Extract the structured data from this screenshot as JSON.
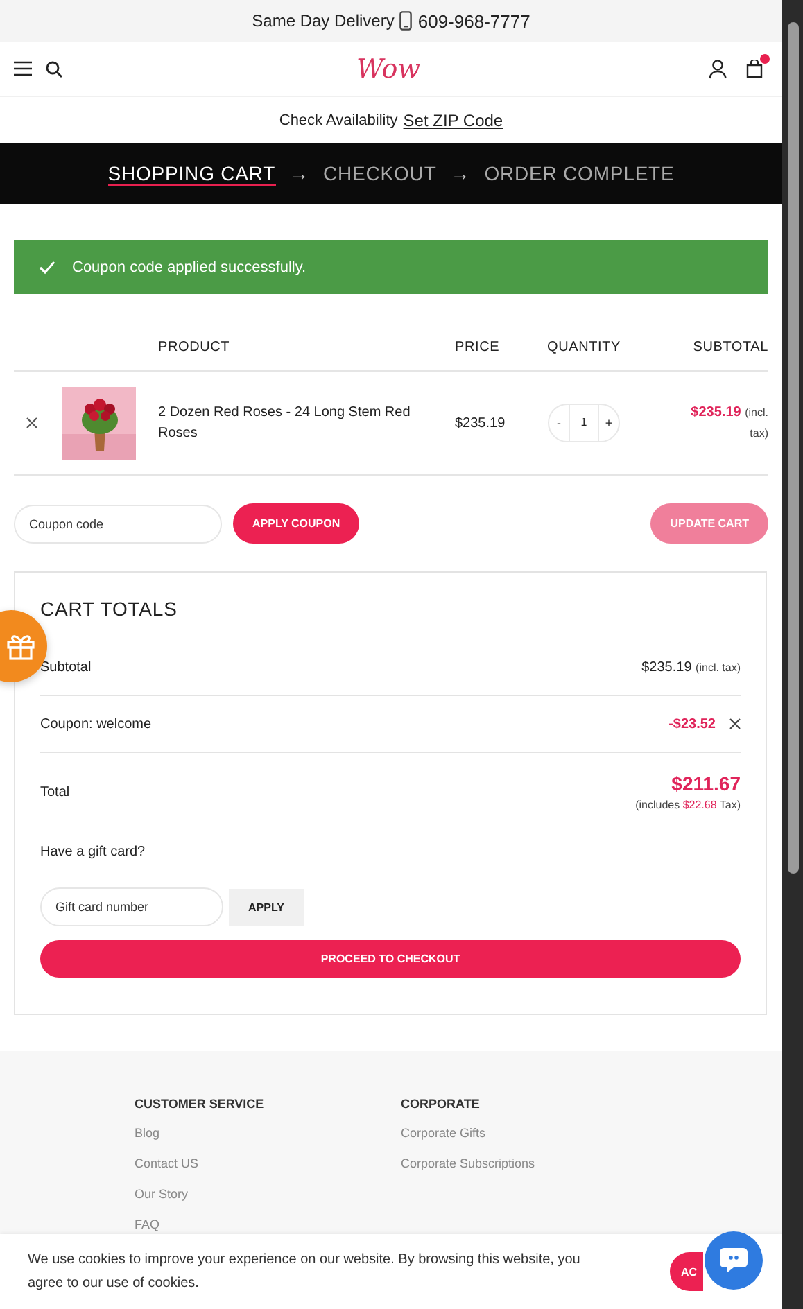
{
  "top_bar": {
    "text": "Same Day Delivery",
    "phone": "609-968-7777"
  },
  "header": {
    "logo": "Wow",
    "cart_badge": true
  },
  "zip_bar": {
    "label": "Check Availability",
    "link": "Set ZIP Code"
  },
  "steps": [
    {
      "label": "SHOPPING CART",
      "selected": true
    },
    {
      "label": "CHECKOUT",
      "selected": false
    },
    {
      "label": "ORDER COMPLETE",
      "selected": false
    }
  ],
  "step_separator": "→",
  "notice": {
    "text": "Coupon code applied successfully."
  },
  "table": {
    "columns": [
      "PRODUCT",
      "PRICE",
      "QUANTITY",
      "SUBTOTAL"
    ],
    "rows": [
      {
        "name": "2 Dozen Red Roses - 24 Long Stem Red Roses",
        "price": "$235.19",
        "quantity": "1",
        "minus": "-",
        "plus": "+",
        "subtotal": "$235.19",
        "subtotal_note": "(incl. tax)"
      }
    ]
  },
  "coupon": {
    "placeholder": "Coupon code",
    "apply": "APPLY COUPON",
    "update": "UPDATE CART",
    "update_disabled": true
  },
  "totals": {
    "title": "CART TOTALS",
    "subtotal_label": "Subtotal",
    "subtotal": "$235.19",
    "subtotal_note": "(incl. tax)",
    "coupon_label": "Coupon: welcome",
    "coupon_amount": "-$23.52",
    "total_label": "Total",
    "total": "$211.67",
    "tax_prefix": "(includes",
    "tax": "$22.68",
    "tax_suffix": "Tax)",
    "gift_question": "Have a gift card?",
    "gift_placeholder": "Gift card number",
    "gift_apply": "APPLY",
    "checkout": "PROCEED TO CHECKOUT"
  },
  "footer": {
    "columns": [
      {
        "title": "CUSTOMER SERVICE",
        "links": [
          "Blog",
          "Contact US",
          "Our Story",
          "FAQ"
        ]
      },
      {
        "title": "CORPORATE",
        "links": [
          "Corporate Gifts",
          "Corporate Subscriptions"
        ]
      }
    ]
  },
  "cookie": {
    "text": "We use cookies to improve your experience on our website. By browsing this website, you agree to our use of cookies.",
    "button": "AC"
  }
}
